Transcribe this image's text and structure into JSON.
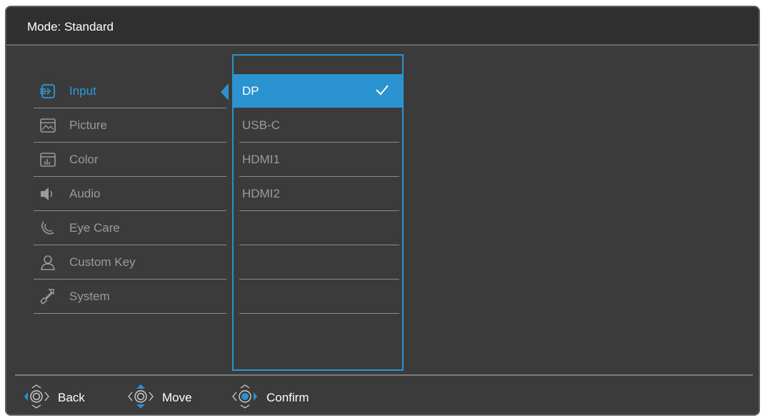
{
  "header": {
    "mode_title": "Mode: Standard"
  },
  "colors": {
    "accent": "#2b93cf",
    "background": "#3b3b3b",
    "inactive_text": "#9a9a9a"
  },
  "menu": {
    "items": [
      {
        "label": "Input",
        "icon": "input-icon",
        "active": true
      },
      {
        "label": "Picture",
        "icon": "picture-icon",
        "active": false
      },
      {
        "label": "Color",
        "icon": "color-icon",
        "active": false
      },
      {
        "label": "Audio",
        "icon": "speaker-icon",
        "active": false
      },
      {
        "label": "Eye Care",
        "icon": "eye-care-icon",
        "active": false
      },
      {
        "label": "Custom Key",
        "icon": "user-icon",
        "active": false
      },
      {
        "label": "System",
        "icon": "wrench-icon",
        "active": false
      }
    ]
  },
  "submenu": {
    "items": [
      {
        "label": "DP",
        "selected": true
      },
      {
        "label": "USB-C",
        "selected": false
      },
      {
        "label": "HDMI1",
        "selected": false
      },
      {
        "label": "HDMI2",
        "selected": false
      }
    ]
  },
  "footer": {
    "back_label": "Back",
    "move_label": "Move",
    "confirm_label": "Confirm"
  }
}
